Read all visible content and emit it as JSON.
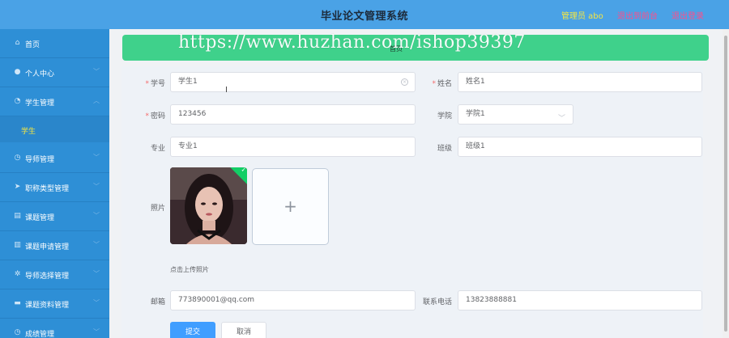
{
  "header": {
    "title": "毕业论文管理系统",
    "admin": "管理员 abo",
    "front_link": "退出到前台",
    "logout_link": "退出登录"
  },
  "sidebar": {
    "items": [
      {
        "label": "首页",
        "icon": "home-icon"
      },
      {
        "label": "个人中心",
        "icon": "user-icon"
      },
      {
        "label": "学生管理",
        "icon": "student-icon"
      },
      {
        "label": "导师管理",
        "icon": "clock-icon"
      },
      {
        "label": "职称类型管理",
        "icon": "send-icon"
      },
      {
        "label": "课题管理",
        "icon": "doc-icon"
      },
      {
        "label": "课题申请管理",
        "icon": "chart-icon"
      },
      {
        "label": "导师选择管理",
        "icon": "gear-icon"
      },
      {
        "label": "课题资料管理",
        "icon": "message-icon"
      },
      {
        "label": "成绩管理",
        "icon": "clock-icon"
      }
    ],
    "sub_active": "学生"
  },
  "watermark": "https://www.huzhan.com/ishop39397",
  "crumb": "首页",
  "form": {
    "student_no": {
      "label": "学号",
      "value": "学生1"
    },
    "name": {
      "label": "姓名",
      "value": "姓名1"
    },
    "password": {
      "label": "密码",
      "value": "123456"
    },
    "college": {
      "label": "学院",
      "value": "学院1"
    },
    "major": {
      "label": "专业",
      "value": "专业1"
    },
    "class": {
      "label": "班级",
      "value": "班级1"
    },
    "photo": {
      "label": "照片",
      "hint": "点击上传照片"
    },
    "email": {
      "label": "邮箱",
      "value": "773890001@qq.com"
    },
    "phone": {
      "label": "联系电话",
      "value": "13823888881"
    },
    "submit": "提交",
    "cancel": "取消"
  },
  "colors": {
    "header_bg": "#4aa2e6",
    "sidebar_bg": "#2e8fd6",
    "accent_green": "#3fd18b",
    "primary": "#409eff"
  }
}
